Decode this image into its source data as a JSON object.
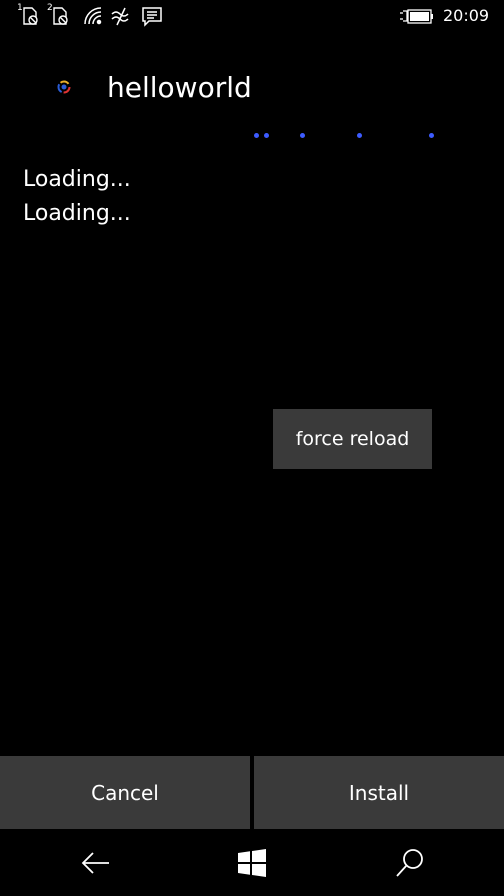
{
  "status_bar": {
    "sim1_label": "1",
    "sim2_label": "2",
    "time": "20:09",
    "icons": [
      "sim-1-no-signal-icon",
      "sim-2-no-signal-icon",
      "wifi-icon",
      "mobile-data-icon",
      "notification-icon",
      "battery-charging-icon"
    ]
  },
  "header": {
    "app_icon": "app-icon",
    "app_name": "helloworld"
  },
  "main": {
    "loading_lines": [
      "Loading...",
      "Loading..."
    ],
    "force_reload_label": "force reload"
  },
  "actions": {
    "cancel_label": "Cancel",
    "install_label": "Install"
  },
  "nav": {
    "icons": [
      "back-icon",
      "windows-start-icon",
      "search-icon"
    ]
  },
  "colors": {
    "background": "#000000",
    "button_bg": "#3a3a3a",
    "text": "#ffffff",
    "accent_dots": "#3d5cff"
  }
}
